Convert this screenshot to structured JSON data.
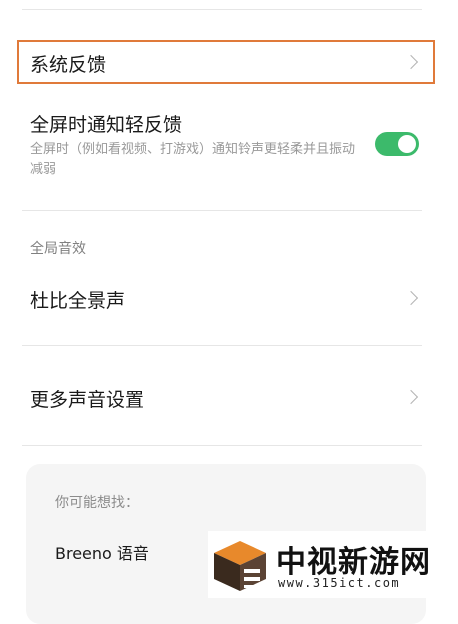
{
  "settings": {
    "system_feedback": {
      "label": "系统反馈"
    },
    "fullscreen_feedback": {
      "label": "全屏时通知轻反馈",
      "description": "全屏时（例如看视频、打游戏）通知铃声更轻柔并且振动减弱",
      "enabled": true
    },
    "global_sound_section": "全局音效",
    "dolby": {
      "label": "杜比全景声"
    },
    "more_sound": {
      "label": "更多声音设置"
    }
  },
  "suggestions": {
    "title": "你可能想找：",
    "items": [
      "Breeno 语音"
    ]
  },
  "watermark": {
    "title": "中视新游网",
    "url": "www.315ict.com"
  },
  "colors": {
    "toggle_on": "#3cba6b",
    "highlight": "#e07a3a"
  }
}
